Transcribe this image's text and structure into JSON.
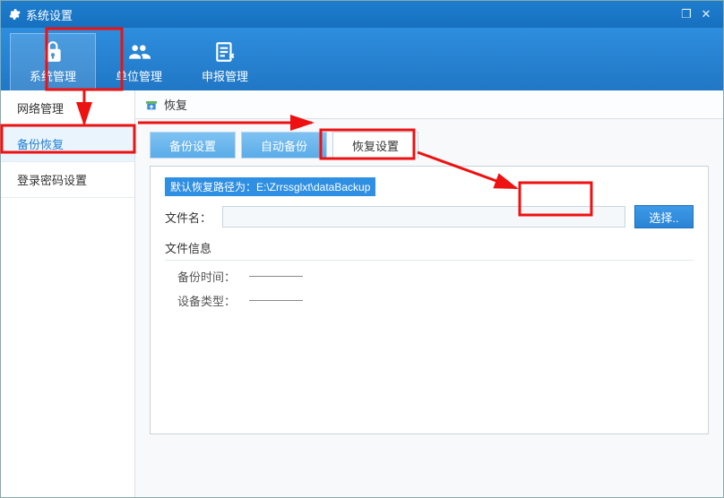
{
  "title": "系统设置",
  "window_controls": {
    "restore_glyph": "❐",
    "close_glyph": "✕"
  },
  "toolbar": [
    {
      "id": "system",
      "label": "系统管理",
      "icon": "lock-icon",
      "active": true
    },
    {
      "id": "org",
      "label": "单位管理",
      "icon": "users-icon",
      "active": false
    },
    {
      "id": "declare",
      "label": "申报管理",
      "icon": "form-icon",
      "active": false
    }
  ],
  "sidebar": [
    {
      "id": "network",
      "label": "网络管理",
      "active": false
    },
    {
      "id": "backup",
      "label": "备份恢复",
      "active": true
    },
    {
      "id": "password",
      "label": "登录密码设置",
      "active": false
    }
  ],
  "crumb": {
    "icon": "restore-icon",
    "label": "恢复"
  },
  "tabs": [
    {
      "id": "backup_cfg",
      "label": "备份设置",
      "active": false
    },
    {
      "id": "auto_backup",
      "label": "自动备份",
      "active": false
    },
    {
      "id": "restore_cfg",
      "label": "恢复设置",
      "active": true
    }
  ],
  "panel": {
    "note": "默认恢复路径为：E:\\Zrrssglxt\\dataBackup",
    "file_label": "文件名：",
    "file_value": "",
    "choose_label": "选择..",
    "info_title": "文件信息",
    "backup_time_label": "备份时间：",
    "backup_time_value": "——",
    "device_type_label": "设备类型：",
    "device_type_value": "——"
  }
}
